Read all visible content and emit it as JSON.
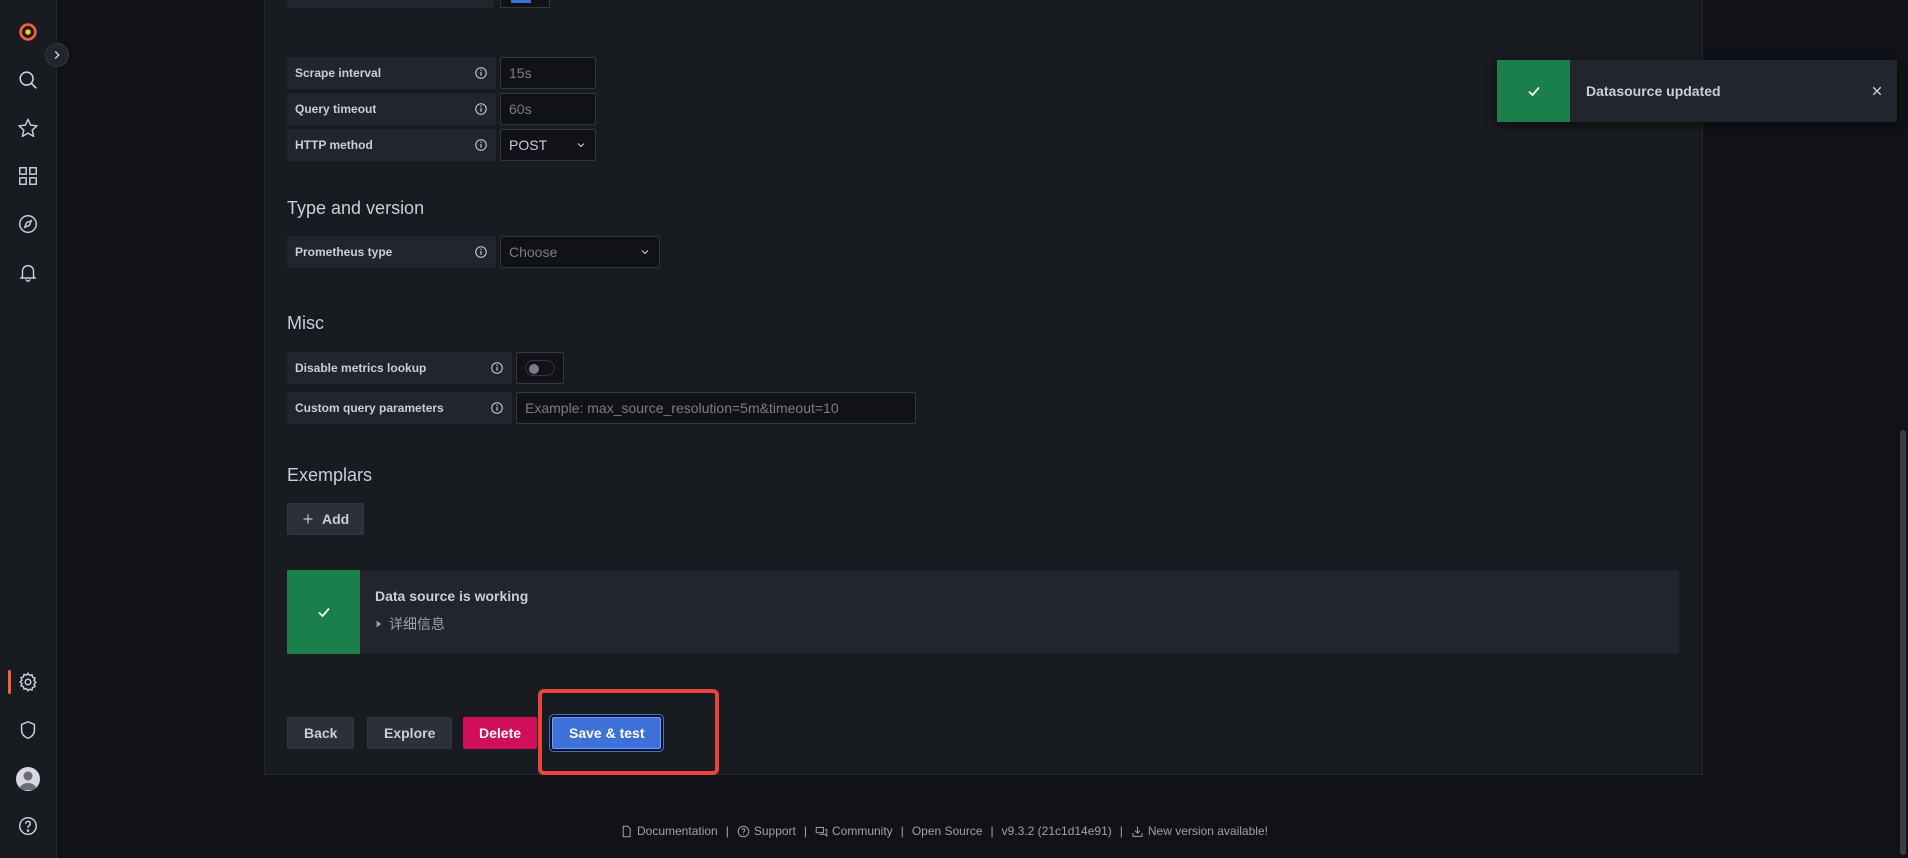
{
  "sidebar": {
    "icons": [
      "grafana-logo-icon",
      "search-icon",
      "star-icon",
      "dashboards-icon",
      "explore-icon",
      "bell-icon",
      "gear-icon",
      "shield-icon",
      "avatar",
      "help-icon"
    ]
  },
  "settings": {
    "scrape_interval": {
      "label": "Scrape interval",
      "placeholder": "15s"
    },
    "query_timeout": {
      "label": "Query timeout",
      "placeholder": "60s"
    },
    "http_method": {
      "label": "HTTP method",
      "value": "POST"
    }
  },
  "type_version": {
    "title": "Type and version",
    "prometheus_type": {
      "label": "Prometheus type",
      "placeholder": "Choose"
    }
  },
  "misc": {
    "title": "Misc",
    "disable_metrics": {
      "label": "Disable metrics lookup",
      "enabled": false
    },
    "custom_params": {
      "label": "Custom query parameters",
      "placeholder": "Example: max_source_resolution=5m&timeout=10"
    }
  },
  "exemplars": {
    "title": "Exemplars",
    "add_label": "Add"
  },
  "status_alert": {
    "title": "Data source is working",
    "details": "详细信息",
    "color": "#1a7f4b"
  },
  "buttons": {
    "back": "Back",
    "explore": "Explore",
    "delete": "Delete",
    "save_test": "Save & test"
  },
  "toast": {
    "message": "Datasource updated"
  },
  "footer": {
    "documentation": "Documentation",
    "support": "Support",
    "community": "Community",
    "open_source": "Open Source",
    "version": "v9.3.2 (21c1d14e91)",
    "new_version": "New version available!"
  }
}
